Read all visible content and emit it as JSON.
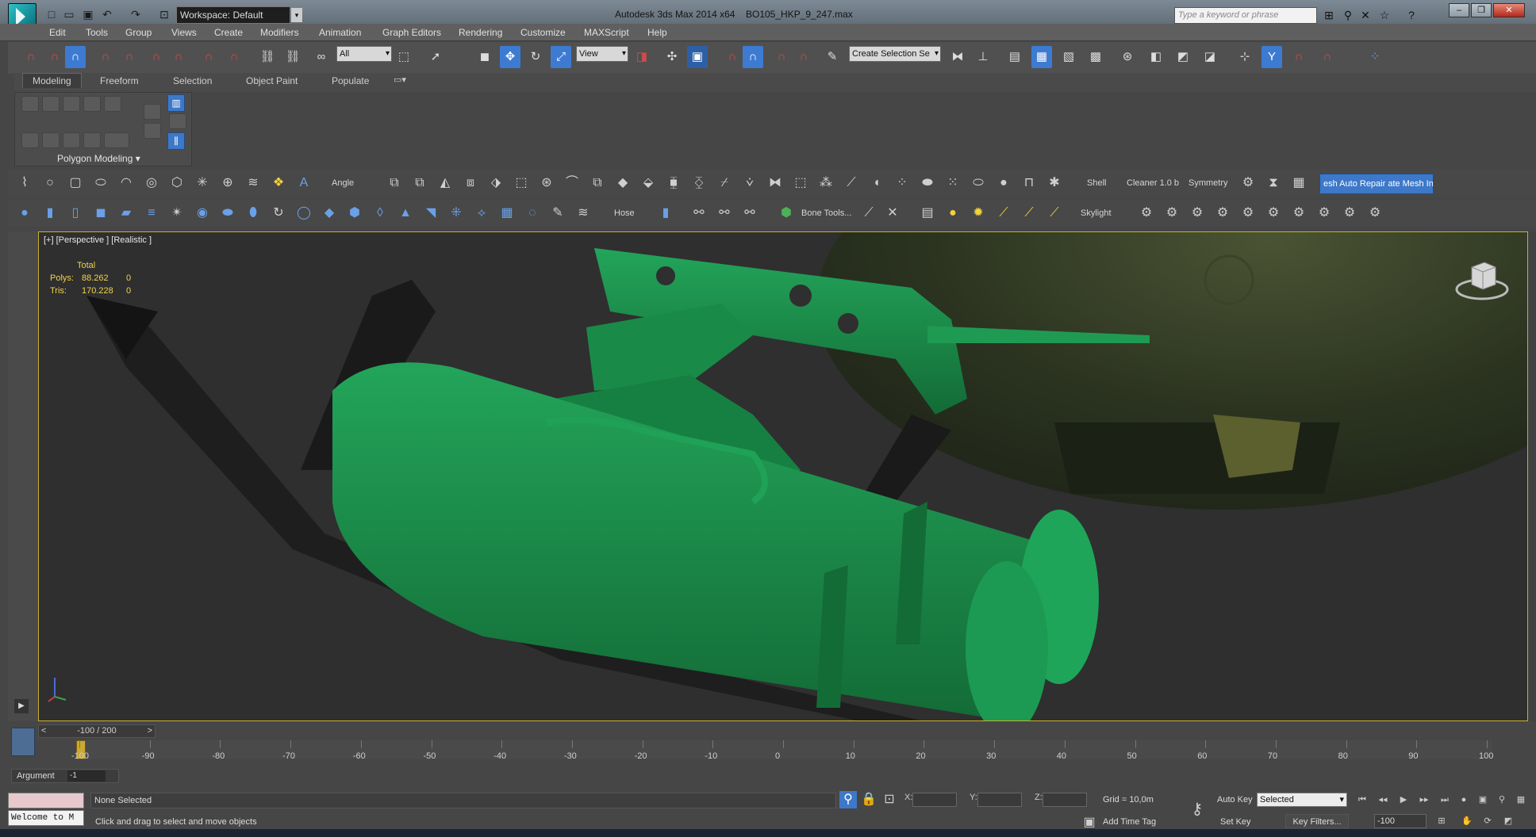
{
  "titlebar": {
    "workspace": "Workspace: Default",
    "app_title": "Autodesk 3ds Max  2014 x64",
    "file_name": "BO105_HKP_9_247.max",
    "search_placeholder": "Type a keyword or phrase",
    "quick_access_icons": [
      "new-file-icon",
      "open-file-icon",
      "save-icon",
      "undo-icon",
      "redo-icon",
      "project-folder-icon"
    ],
    "right_icons": [
      "binoculars-icon",
      "search-icon",
      "exchange-icon",
      "favorites-star-icon",
      "help-icon"
    ],
    "window_buttons": [
      "minimize",
      "restore",
      "close"
    ]
  },
  "menu": [
    "Edit",
    "Tools",
    "Group",
    "Views",
    "Create",
    "Modifiers",
    "Animation",
    "Graph Editors",
    "Rendering",
    "Customize",
    "MAXScript",
    "Help"
  ],
  "maintoolbar": {
    "selection_filter": "All",
    "reference_coord": "View",
    "named_selection": "Create Selection Se"
  },
  "ribbon": {
    "tabs": [
      "Modeling",
      "Freeform",
      "Selection",
      "Object Paint",
      "Populate"
    ],
    "active_tab": "Modeling",
    "panel_label": "Polygon Modeling"
  },
  "graphite_row1": {
    "angle_label": "Angle",
    "shell_label": "Shell",
    "cleaner_label": "Cleaner 1.0 b",
    "symmetry_label": "Symmetry",
    "mesh_button": "esh Auto Repair  ate Mesh Insp"
  },
  "graphite_row2": {
    "hose_label": "Hose",
    "bone_tools_label": "Bone Tools...",
    "skylight_label": "Skylight"
  },
  "viewport": {
    "label": "[+] [Perspective ] [Realistic ]",
    "stats_header": "Total",
    "stats": [
      {
        "name": "Polys:",
        "total": "88.262",
        "sel": "0"
      },
      {
        "name": "Tris:",
        "total": "170.228",
        "sel": "0"
      }
    ],
    "model_color": "#1e8c4c",
    "fuselage_color": "#303b22"
  },
  "timeline": {
    "slider_text": "-100 / 200",
    "ticks": [
      "-100",
      "-90",
      "-80",
      "-70",
      "-60",
      "-50",
      "-40",
      "-30",
      "-20",
      "-10",
      "0",
      "10",
      "20",
      "30",
      "40",
      "50",
      "60",
      "70",
      "80",
      "90",
      "100"
    ],
    "argument_label": "Argument",
    "argument_value": "-1"
  },
  "status": {
    "welcome": "Welcome to M",
    "selection": "None Selected",
    "prompt": "Click and drag to select and move objects",
    "x_label": "X:",
    "y_label": "Y:",
    "z_label": "Z:",
    "grid": "Grid = 10,0m",
    "add_time_tag": "Add Time Tag",
    "auto_key": "Auto Key",
    "set_key": "Set Key",
    "key_mode": "Selected",
    "key_filters": "Key Filters...",
    "current_frame": "-100"
  }
}
